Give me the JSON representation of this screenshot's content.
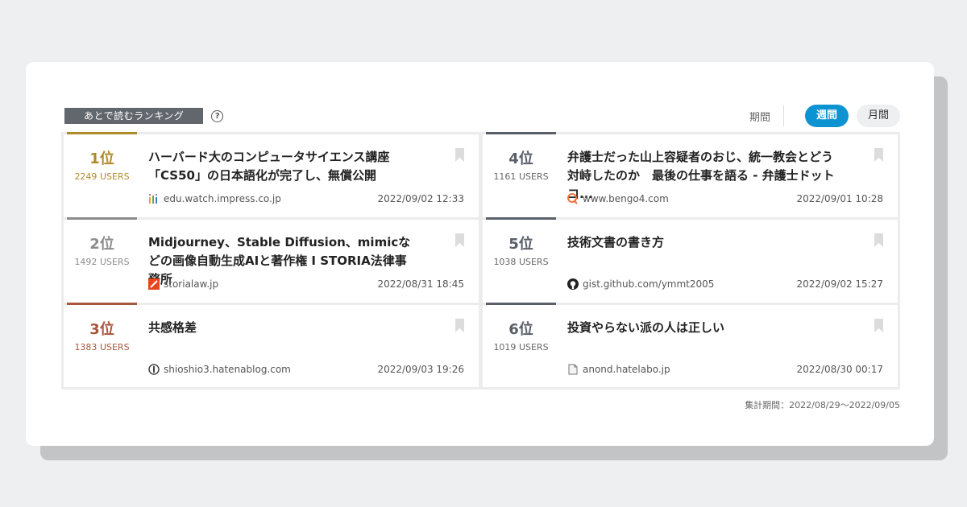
{
  "header": {
    "ranking_label": "あとで読むランキング",
    "help_icon": "?",
    "period_label": "期間",
    "period_options": [
      "週間",
      "月間"
    ],
    "period_selected": "週間"
  },
  "items": [
    {
      "rank": "1位",
      "users": "2249",
      "users_suffix": "USERS",
      "title": "ハーバード大のコンピュータサイエンス講座「CS50」の日本語化が完了し、無償公開",
      "domain": "edu.watch.impress.co.jp",
      "date": "2022/09/02 12:33",
      "rank_color": "#b08b2a",
      "favicon": "impress-icon"
    },
    {
      "rank": "2位",
      "users": "1492",
      "users_suffix": "USERS",
      "title": "Midjourney、Stable Diffusion、mimicなどの画像自動生成AIと著作権 I STORIA法律事務所",
      "domain": "storialaw.jp",
      "date": "2022/08/31 18:45",
      "rank_color": "#8c8c8c",
      "favicon": "storia-icon"
    },
    {
      "rank": "3位",
      "users": "1383",
      "users_suffix": "USERS",
      "title": "共感格差",
      "domain": "shioshio3.hatenablog.com",
      "date": "2022/09/03 19:26",
      "rank_color": "#a9563f",
      "favicon": "hatenablog-icon"
    },
    {
      "rank": "4位",
      "users": "1161",
      "users_suffix": "USERS",
      "title": "弁護士だった山上容疑者のおじ、統一教会とどう対峙したのか　最後の仕事を語る - 弁護士ドットコ...",
      "domain": "www.bengo4.com",
      "date": "2022/09/01 10:28",
      "rank_color": "#5a6069",
      "favicon": "bengo4-icon"
    },
    {
      "rank": "5位",
      "users": "1038",
      "users_suffix": "USERS",
      "title": "技術文書の書き方",
      "domain": "gist.github.com/ymmt2005",
      "date": "2022/09/02 15:27",
      "rank_color": "#5a6069",
      "favicon": "github-icon"
    },
    {
      "rank": "6位",
      "users": "1019",
      "users_suffix": "USERS",
      "title": "投資やらない派の人は正しい",
      "domain": "anond.hatelabo.jp",
      "date": "2022/08/30 00:17",
      "rank_color": "#5a6069",
      "favicon": "document-icon"
    }
  ],
  "footer": {
    "period_note": "集計期間：2022/08/29〜2022/09/05"
  }
}
